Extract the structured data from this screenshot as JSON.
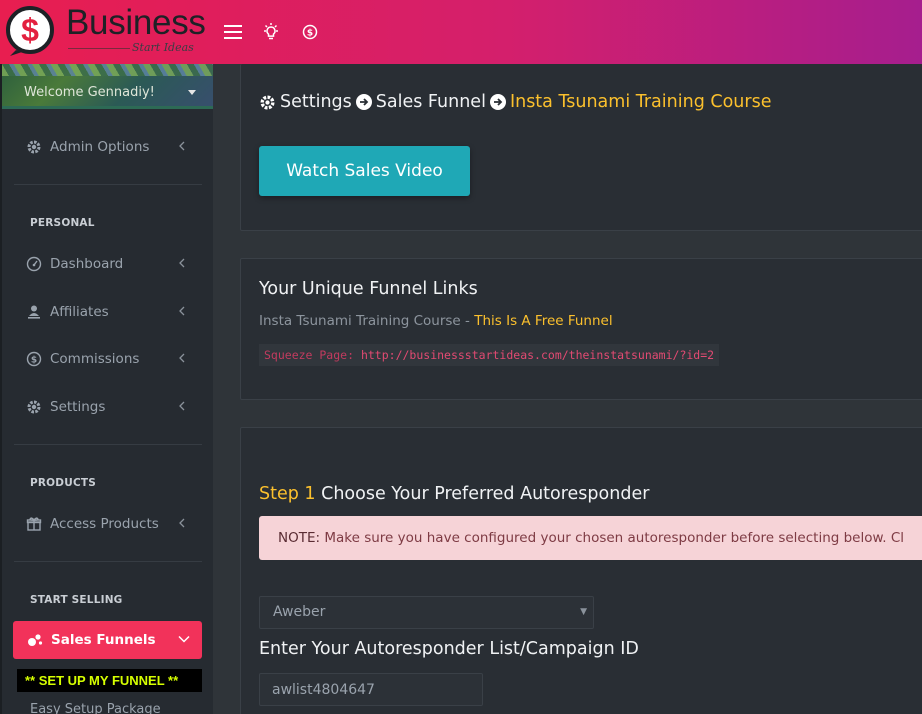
{
  "brand": {
    "name": "Business",
    "tagline": "Start Ideas"
  },
  "topbar": {
    "icons": [
      "hamburger-icon",
      "lightbulb-icon",
      "dollar-coin-icon"
    ]
  },
  "sidebar": {
    "welcome": "Welcome Gennadiy!",
    "admin_options": "Admin Options",
    "sections": {
      "personal": "PERSONAL",
      "products": "PRODUCTS",
      "start_selling": "START SELLING"
    },
    "personal_items": [
      {
        "label": "Dashboard",
        "icon": "speedometer-icon"
      },
      {
        "label": "Affiliates",
        "icon": "user-icon"
      },
      {
        "label": "Commissions",
        "icon": "dollar-coin-icon"
      },
      {
        "label": "Settings",
        "icon": "gear-icon"
      }
    ],
    "products_items": [
      {
        "label": "Access Products",
        "icon": "gift-icon"
      }
    ],
    "sales_funnels": "Sales Funnels",
    "setup_funnel": "** SET UP MY FUNNEL **",
    "easy_setup": "Easy Setup Package"
  },
  "breadcrumb": {
    "items": [
      "Settings",
      "Sales Funnel"
    ],
    "current": "Insta Tsunami Training Course"
  },
  "watch_button": "Watch Sales Video",
  "funnel_links": {
    "heading": "Your Unique Funnel Links",
    "course": "Insta Tsunami Training Course - ",
    "free_label": "This Is A Free Funnel",
    "squeeze_label": "Squeeze Page:",
    "squeeze_url": "http://businessstartideas.com/theinstatsunami/?id=2"
  },
  "step1": {
    "number": "Step 1",
    "title": "Choose Your Preferred Autoresponder",
    "note_label": "NOTE:",
    "note_text": "Make sure you have configured your chosen autoresponder before selecting below. Cl",
    "selected": "Aweber",
    "list_label": "Enter Your Autoresponder List/Campaign ID",
    "list_value": "awlist4804647"
  },
  "colors": {
    "accent": "#f2325a",
    "highlight": "#fbc02d",
    "teal": "#1fa8b6"
  }
}
